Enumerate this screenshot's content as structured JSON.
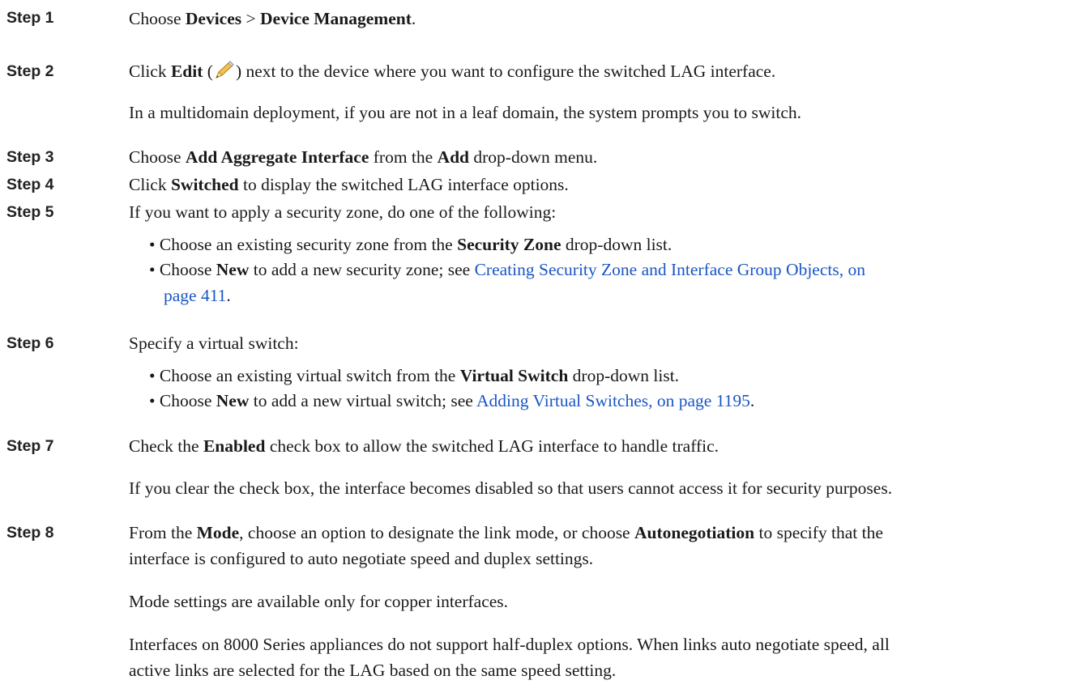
{
  "steps": [
    {
      "label": "Step 1",
      "parts": [
        "Choose ",
        "Devices",
        " > ",
        "Device Management",
        "."
      ]
    },
    {
      "label": "Step 2",
      "parts": [
        "Click ",
        "Edit",
        " (",
        ") next to the device where you want to configure the switched LAG interface."
      ],
      "note": "In a multidomain deployment, if you are not in a leaf domain, the system prompts you to switch."
    },
    {
      "label": "Step 3",
      "parts": [
        "Choose ",
        "Add Aggregate Interface",
        " from the ",
        "Add",
        " drop-down menu."
      ]
    },
    {
      "label": "Step 4",
      "parts": [
        "Click ",
        "Switched",
        " to display the switched LAG interface options."
      ]
    },
    {
      "label": "Step 5",
      "parts": [
        "If you want to apply a security zone, do one of the following:"
      ],
      "bullets": [
        {
          "parts": [
            "• Choose an existing security zone from the ",
            "Security Zone",
            " drop-down list."
          ]
        },
        {
          "parts": [
            "• Choose ",
            "New",
            " to add a new security zone; see "
          ],
          "link": "Creating Security Zone and Interface Group Objects, on",
          "link_cont": "page 411",
          "tail": "."
        }
      ]
    },
    {
      "label": "Step 6",
      "parts": [
        "Specify a virtual switch:"
      ],
      "bullets": [
        {
          "parts": [
            "• Choose an existing virtual switch from the ",
            "Virtual Switch",
            " drop-down list."
          ]
        },
        {
          "parts": [
            "• Choose ",
            "New",
            " to add a new virtual switch; see "
          ],
          "link": "Adding Virtual Switches, on page 1195",
          "tail": "."
        }
      ]
    },
    {
      "label": "Step 7",
      "parts": [
        "Check the ",
        "Enabled",
        " check box to allow the switched LAG interface to handle traffic."
      ],
      "note": "If you clear the check box, the interface becomes disabled so that users cannot access it for security purposes."
    },
    {
      "label": "Step 8",
      "parts": [
        "From the ",
        "Mode",
        ", choose an option to designate the link mode, or choose ",
        "Autonegotiation",
        " to specify that the"
      ],
      "line2": "interface is configured to auto negotiate speed and duplex settings.",
      "note": "Mode settings are available only for copper interfaces.",
      "note2_line1": "Interfaces on 8000 Series appliances do not support half-duplex options. When links auto negotiate speed, all",
      "note2_line2": "active links are selected for the LAG based on the same speed setting."
    }
  ],
  "icons": {
    "edit": "pencil-icon"
  }
}
